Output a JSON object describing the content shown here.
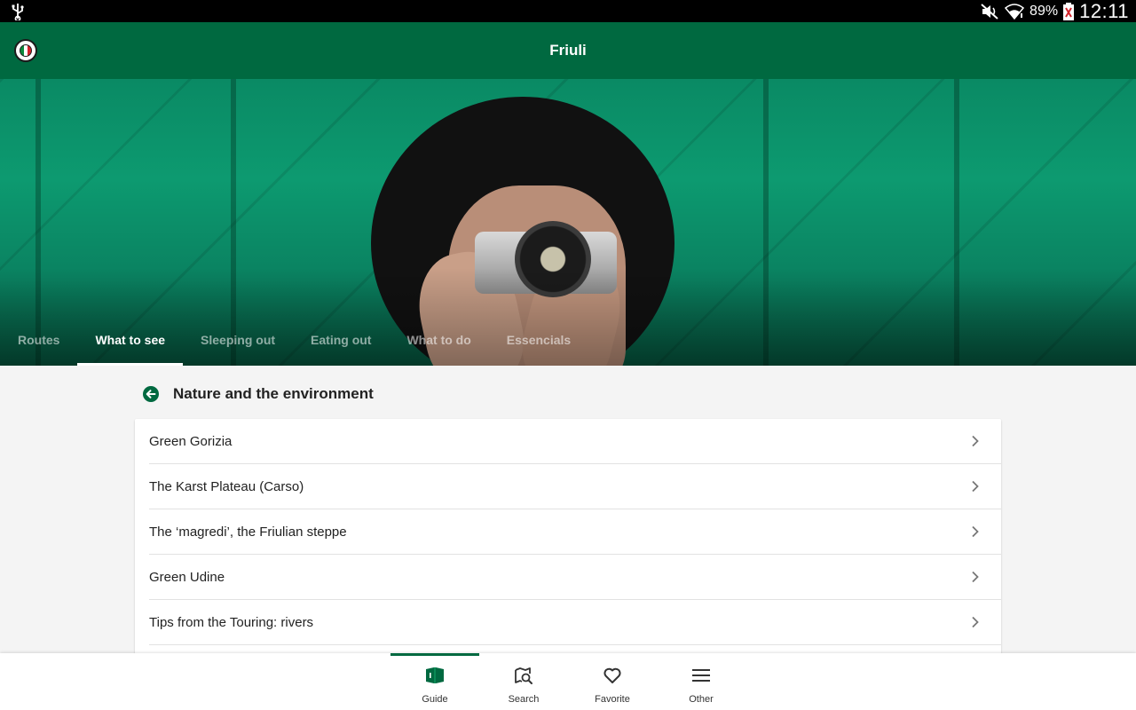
{
  "status_bar": {
    "battery_percent": "89%",
    "clock": "12:11",
    "icons": [
      "usb-icon",
      "mute-icon",
      "wifi-icon",
      "battery-alert-icon"
    ]
  },
  "app_bar": {
    "title": "Friuli",
    "logo_icon": "touring-club-logo"
  },
  "tabs": [
    {
      "label": "Routes",
      "active": false
    },
    {
      "label": "What to see",
      "active": true
    },
    {
      "label": "Sleeping out",
      "active": false
    },
    {
      "label": "Eating out",
      "active": false
    },
    {
      "label": "What to do",
      "active": false
    },
    {
      "label": "Essencials",
      "active": false
    }
  ],
  "section": {
    "title": "Nature and the environment",
    "back_icon": "arrow-back-circle-icon",
    "accent_color": "#006940"
  },
  "list": [
    {
      "label": "Green Gorizia"
    },
    {
      "label": "The Karst Plateau (Carso)"
    },
    {
      "label": "The ‘magredi’, the Friulian steppe"
    },
    {
      "label": "Green Udine"
    },
    {
      "label": "Tips from the Touring: rivers"
    }
  ],
  "bottom_nav": [
    {
      "label": "Guide",
      "icon": "book-icon",
      "active": true
    },
    {
      "label": "Search",
      "icon": "search-map-icon",
      "active": false
    },
    {
      "label": "Favorite",
      "icon": "heart-icon",
      "active": false
    },
    {
      "label": "Other",
      "icon": "menu-icon",
      "active": false
    }
  ],
  "colors": {
    "primary": "#006940",
    "status_bar": "#000000",
    "background": "#f4f4f4"
  }
}
